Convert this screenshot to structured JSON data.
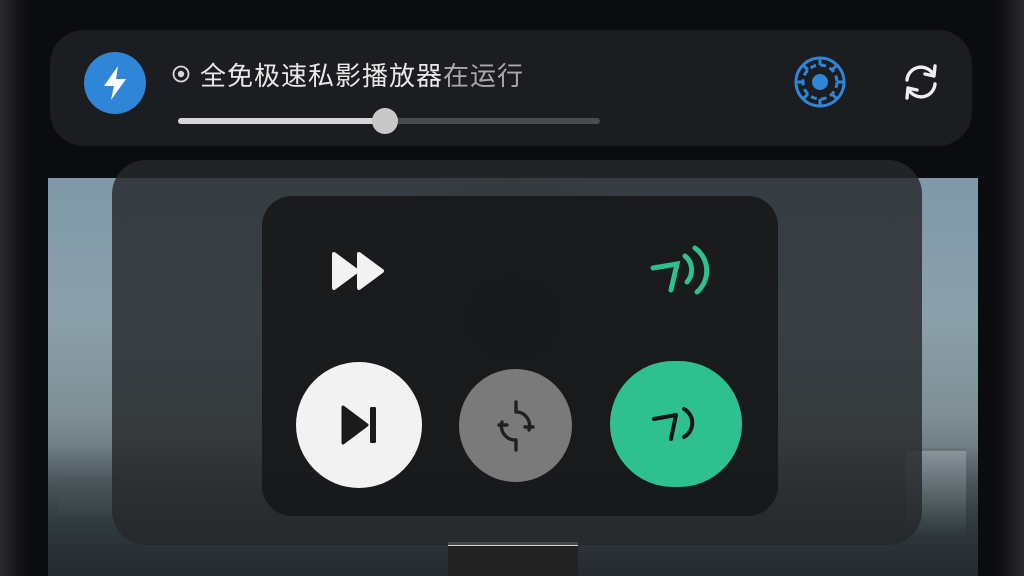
{
  "notification": {
    "app_name": "全免极速私影播放器",
    "status": "在运行",
    "progress": 0.49
  },
  "icons": {
    "app": "lightning-icon",
    "record": "record-icon",
    "settings": "gear-icon",
    "refresh": "refresh-icon",
    "fast_forward": "fast-forward-icon",
    "signal": "cast-signal-icon",
    "skip_next": "skip-next-icon",
    "rotate": "rotate-icon",
    "cast": "cast-icon"
  },
  "colors": {
    "accent_blue": "#2f86d6",
    "accent_green": "#2fc08f",
    "panel": "#1c1d20"
  }
}
